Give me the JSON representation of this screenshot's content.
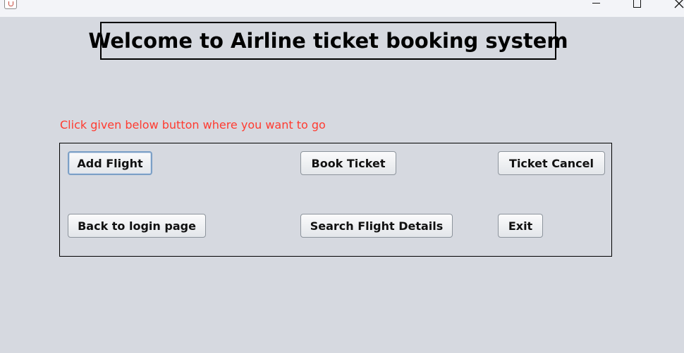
{
  "window": {
    "icon": "java-cup-icon",
    "controls": [
      "minimize-icon",
      "maximize-icon",
      "close-icon"
    ]
  },
  "header": {
    "title": "Welcome to Airline ticket booking system"
  },
  "hint": {
    "text": "Click given below button where you want to go",
    "color": "#ff3b30"
  },
  "buttons": {
    "add_flight": "Add Flight",
    "book_ticket": "Book Ticket",
    "ticket_cancel": "Ticket Cancel",
    "back_to_login": "Back to login page",
    "search_flight": "Search Flight Details",
    "exit": "Exit"
  },
  "colors": {
    "background": "#d6d9e0",
    "titlebar": "#f3f4f8",
    "focus_ring": "#7b9fc6"
  }
}
